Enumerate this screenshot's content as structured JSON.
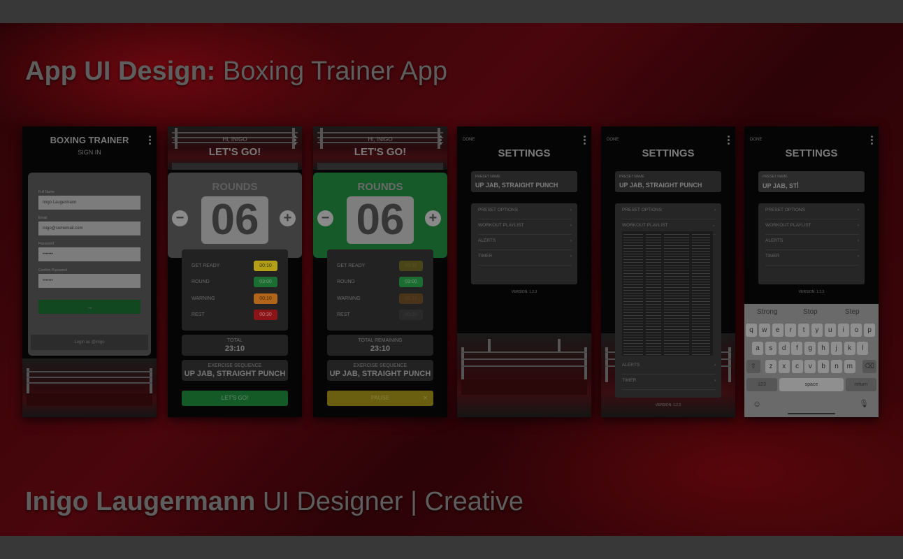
{
  "headline": {
    "bold": "App UI Design:",
    "rest": " Boxing Trainer App"
  },
  "footer": {
    "bold": "Inigo Laugermann",
    "rest": " UI Designer | Creative"
  },
  "login": {
    "title": "BOXING TRAINER",
    "subtitle": "SIGN IN",
    "fields": [
      {
        "label": "Full Name",
        "value": "Inigo Laugermann"
      },
      {
        "label": "Email",
        "value": "inigo@somemail.com"
      },
      {
        "label": "Password",
        "value": "•••••••"
      },
      {
        "label": "Confirm Password",
        "value": "•••••••"
      }
    ],
    "submit_icon": "→",
    "login_as": "Login as @inigo"
  },
  "trainer": {
    "greeting": "HI, INIGO",
    "heading": "LET'S GO!",
    "rounds_label": "ROUNDS",
    "rounds_value": "06",
    "minus": "−",
    "plus": "+",
    "timers": [
      {
        "label": "GET READY",
        "value": "00:10",
        "color": "#b3a016"
      },
      {
        "label": "ROUND",
        "value": "03:00",
        "color": "#1b6e32"
      },
      {
        "label": "WARNING",
        "value": "00:10",
        "color": "#b0651a"
      },
      {
        "label": "REST",
        "value": "00:30",
        "color": "#8a1418"
      }
    ],
    "total_label": "TOTAL",
    "total_value": "23:10",
    "sequence_label": "EXERCISE SEQUENCE",
    "sequence_value": "UP JAB, STRAIGHT PUNCH",
    "go_button": "LET'S GO!"
  },
  "trainer_active": {
    "greeting": "HI, INIGO",
    "heading": "LET'S GO!",
    "rounds_label": "ROUNDS",
    "rounds_value": "06",
    "timers": [
      {
        "label": "GET READY",
        "value": "00:10",
        "color": "#4a4419"
      },
      {
        "label": "ROUND",
        "value": "03:00",
        "color": "#1b6e32"
      },
      {
        "label": "WARNING",
        "value": "00:10",
        "color": "#4a3419"
      },
      {
        "label": "REST",
        "value": "00:30",
        "color": "#2a2a2a"
      }
    ],
    "total_label": "TOTAL REMAINING",
    "total_value": "23:10",
    "sequence_label": "EXERCISE SEQUENCE",
    "sequence_value": "UP JAB, STRAIGHT PUNCH",
    "pause_button": "PAUSE",
    "close": "✕"
  },
  "settings": {
    "done": "DONE",
    "title": "SETTINGS",
    "preset_label": "PRESET NAME",
    "preset_value": "UP JAB, STRAIGHT PUNCH",
    "items": [
      "PRESET OPTIONS",
      "WORKOUT PLAYLIST",
      "ALERTS",
      "TIMER"
    ],
    "version": "VERSION: 1.2.3"
  },
  "settings_playlist": {
    "done": "DONE",
    "title": "SETTINGS",
    "preset_label": "PRESET NAME",
    "preset_value": "UP JAB, STRAIGHT PUNCH",
    "items": [
      "PRESET OPTIONS",
      "WORKOUT PLAYLIST",
      "ALERTS",
      "TIMER"
    ],
    "version": "VERSION: 1.2.3"
  },
  "settings_typing": {
    "done": "DONE",
    "title": "SETTINGS",
    "preset_label": "PRESET NAME",
    "preset_value": "UP JAB, ST",
    "items": [
      "PRESET OPTIONS",
      "WORKOUT PLAYLIST",
      "ALERTS",
      "TIMER"
    ],
    "version": "VERSION: 1.2.3",
    "suggestions": [
      "Strong",
      "Stop",
      "Step"
    ],
    "row1": [
      "q",
      "w",
      "e",
      "r",
      "t",
      "y",
      "u",
      "i",
      "o",
      "p"
    ],
    "row2": [
      "a",
      "s",
      "d",
      "f",
      "g",
      "h",
      "j",
      "k",
      "l"
    ],
    "row3": [
      "z",
      "x",
      "c",
      "v",
      "b",
      "n",
      "m"
    ],
    "key_numbers": "123",
    "key_space": "space",
    "key_return": "return",
    "shift_icon": "⇧",
    "delete_icon": "⌫",
    "emoji_icon": "☺",
    "mic_icon": "🎙"
  },
  "chevron": "›",
  "chevron_down": "⌄",
  "back_arrow": "←"
}
